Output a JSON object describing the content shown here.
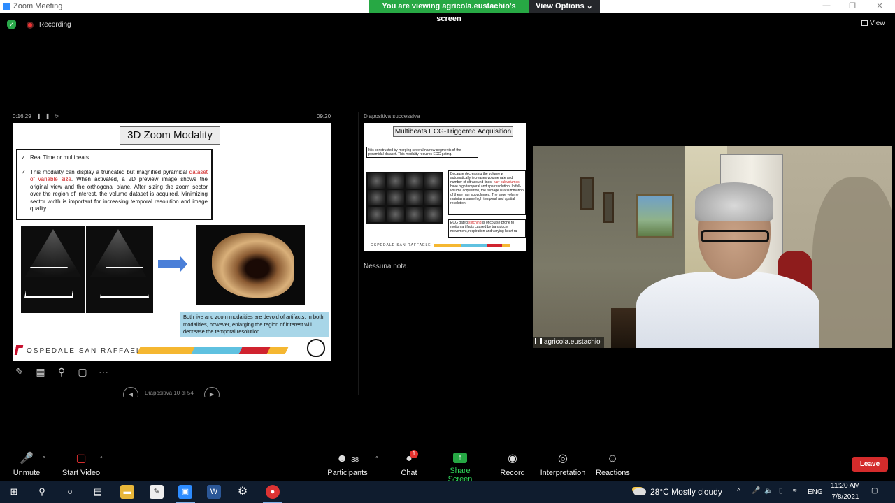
{
  "window": {
    "title": "Zoom Meeting",
    "viewing_banner": "You are viewing agricola.eustachio's screen",
    "view_options": "View Options ⌄"
  },
  "meeting": {
    "recording_label": "Recording",
    "view_label": "View"
  },
  "presenter": {
    "elapsed": "0:16:29",
    "clock": "09:20",
    "slide_nav_label": "Diapositiva 10 di 54",
    "next_label": "Diapositiva successiva",
    "no_notes": "Nessuna nota."
  },
  "slide": {
    "title": "3D Zoom Modality",
    "bullet1": "Real Time or multibeats",
    "bullet2_pre": "This modality can display a truncated but magnified pyramidal ",
    "bullet2_red": "dataset of variable size",
    "bullet2_post": ". When activated, a 2D preview image shows the original view and the orthogonal plane. After sizing the zoom sector over the region of interest, the volume dataset is acquired. Minimizing sector width is important for increasing temporal resolution and image quality.",
    "caption": "Both live and zoom modalities are devoid of artifacts. In both modalities, however, enlarging the region of interest will decrease the temporal resolution",
    "hospital": "OSPEDALE SAN RAFFAELE"
  },
  "next_slide": {
    "title": "Multibeats ECG-Triggered Acquisition",
    "box1": "It is constructed by merging several narrow segments of the pyramidal dataset. This modality requires ECG gating.",
    "text_pre": "Because decreasing the volume w automatically increases volume rate and number of ultrasound lines, ",
    "text_red": "narr subvolumes",
    "text_post": " have high temporal and spa resolution. In full- volume acquisition, the fi image is a summation of these narr subvolumes. The large volume maintains same high temporal and spatial resolution",
    "text2_pre": "ECG gated ",
    "text2_red": "stitching",
    "text2_post": " is of course prone to motion artifacts caused by transducer movement, respiration and varying heart ra",
    "hospital": "OSPEDALE SAN RAFFAELE"
  },
  "participant": {
    "name": "agricola.eustachio"
  },
  "toolbar": {
    "unmute": "Unmute",
    "start_video": "Start Video",
    "participants": "Participants",
    "participants_count": "38",
    "chat": "Chat",
    "chat_badge": "1",
    "share_screen": "Share Screen",
    "record": "Record",
    "interpretation": "Interpretation",
    "reactions": "Reactions",
    "leave": "Leave"
  },
  "taskbar": {
    "weather": "28°C  Mostly cloudy",
    "language": "ENG",
    "time": "11:20 AM",
    "date": "7/8/2021"
  },
  "colors": {
    "accent_green": "#27a844",
    "leave_red": "#d42b2b",
    "badge_red": "#e5312e",
    "taskbar_bg": "#0f1c2e"
  }
}
